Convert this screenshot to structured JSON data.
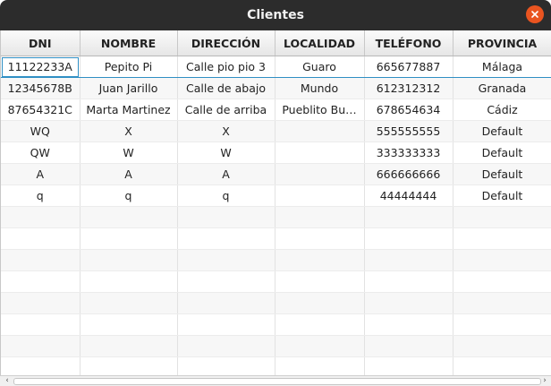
{
  "window": {
    "title": "Clientes",
    "close_icon": "close-icon",
    "accent_color": "#e95420"
  },
  "table": {
    "columns": [
      "DNI",
      "NOMBRE",
      "DIRECCIÓN",
      "LOCALIDAD",
      "TELÉFONO",
      "PROVINCIA"
    ],
    "rows": [
      [
        "11122233A",
        "Pepito Pi",
        "Calle pio pio 3",
        "Guaro",
        "665677887",
        "Málaga"
      ],
      [
        "12345678B",
        "Juan Jarillo",
        "Calle de abajo",
        "Mundo",
        "612312312",
        "Granada"
      ],
      [
        "87654321C",
        "Marta Martinez",
        "Calle de arriba",
        "Pueblito Bu…",
        "678654634",
        "Cádiz"
      ],
      [
        "WQ",
        "X",
        "X",
        "",
        "555555555",
        "Default"
      ],
      [
        "QW",
        "W",
        "W",
        "",
        "333333333",
        "Default"
      ],
      [
        "A",
        "A",
        "A",
        "",
        "666666666",
        "Default"
      ],
      [
        "q",
        "q",
        "q",
        "",
        "44444444",
        "Default"
      ]
    ],
    "selected_row": 0,
    "selection_color": "#2f8fc4"
  },
  "scrollbar": {
    "left_arrow": "‹",
    "right_arrow": "›"
  }
}
